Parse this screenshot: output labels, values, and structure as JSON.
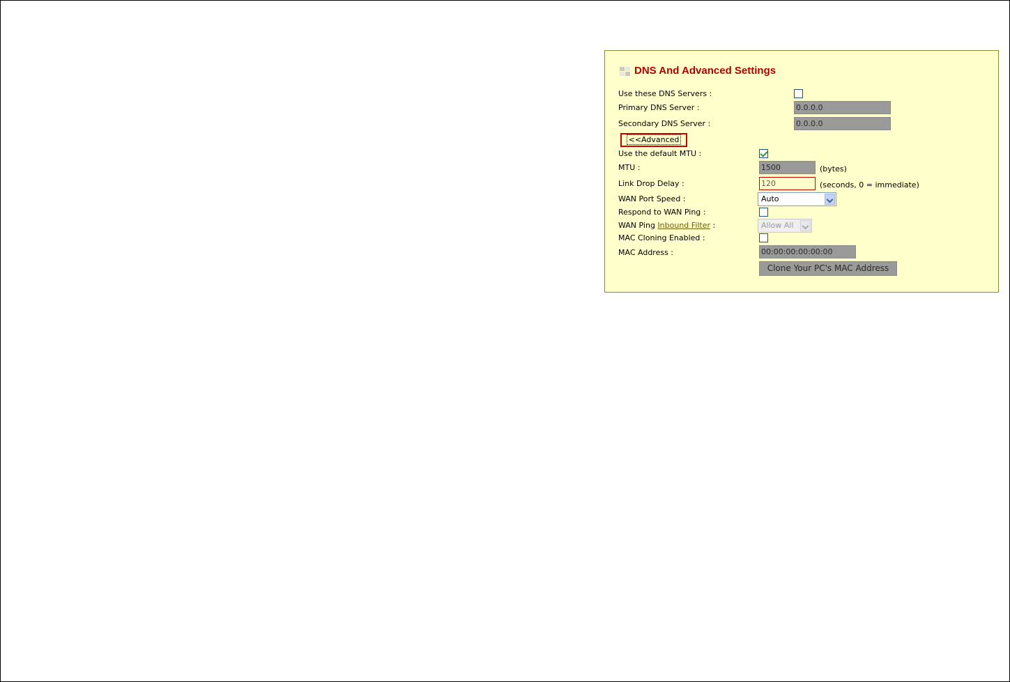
{
  "panel": {
    "title": "DNS And Advanced Settings",
    "icon": "page-section-icon"
  },
  "dns": {
    "use_dns_label": "Use these DNS Servers :",
    "use_dns_checked": false,
    "primary_label": "Primary DNS Server :",
    "primary_value": "0.0.0.0",
    "secondary_label": "Secondary DNS Server :",
    "secondary_value": "0.0.0.0"
  },
  "advanced_button_label": "<<Advanced",
  "advanced": {
    "default_mtu_label": "Use the default MTU :",
    "default_mtu_checked": true,
    "mtu_label": "MTU :",
    "mtu_value": "1500",
    "mtu_unit": "(bytes)",
    "link_drop_label": "Link Drop Delay :",
    "link_drop_value": "120",
    "link_drop_unit": "(seconds, 0 = immediate)",
    "wan_speed_label": "WAN Port Speed :",
    "wan_speed_value": "Auto",
    "respond_ping_label": "Respond to WAN Ping :",
    "respond_ping_checked": false,
    "wan_ping_label_prefix": "WAN Ping",
    "wan_ping_link": "Inbound Filter",
    "wan_ping_label_suffix": ":",
    "wan_ping_filter_value": "Allow All",
    "mac_cloning_label": "MAC Cloning Enabled :",
    "mac_cloning_checked": false,
    "mac_address_label": "MAC Address :",
    "mac_address_value": "00:00:00:00:00:00",
    "clone_button_label": "Clone Your PC's MAC Address"
  }
}
